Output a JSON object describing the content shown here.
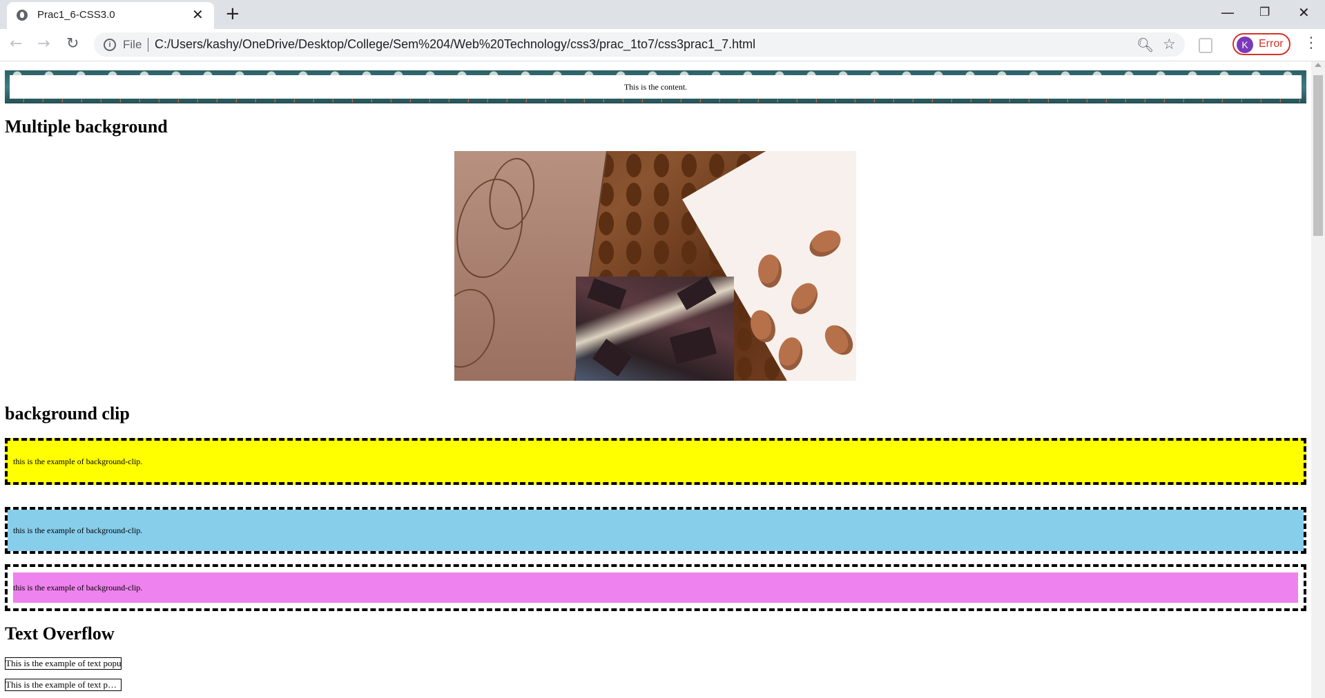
{
  "browser": {
    "tab_title": "Prac1_6-CSS3.0",
    "file_label": "File",
    "url": "C:/Users/kashy/OneDrive/Desktop/College/Sem%204/Web%20Technology/css3/prac_1to7/css3prac1_7.html",
    "profile_initial": "K",
    "profile_status": "Error",
    "icons": [
      "back-icon",
      "forward-icon",
      "reload-icon",
      "info-icon",
      "zoom-icon",
      "star-icon",
      "extension-icon",
      "menu-icon",
      "minimize-icon",
      "restore-icon",
      "close-icon",
      "new-tab-icon",
      "tab-close-icon",
      "globe-icon"
    ]
  },
  "page": {
    "banner_text": "This is the content.",
    "heading_multiple": "Multiple background",
    "heading_clip": "background clip",
    "clip_text_1": "this is the example of background-clip.",
    "clip_text_2": "this is the example of background-clip.",
    "clip_text_3": "this is the example of background-clip.",
    "clip_colors": [
      "#ffff00",
      "#87ceeb",
      "#ee82ee"
    ],
    "heading_overflow": "Text Overflow",
    "overflow_text_1": "This is the example of text popup",
    "overflow_text_2": "This is the example of text popup"
  }
}
